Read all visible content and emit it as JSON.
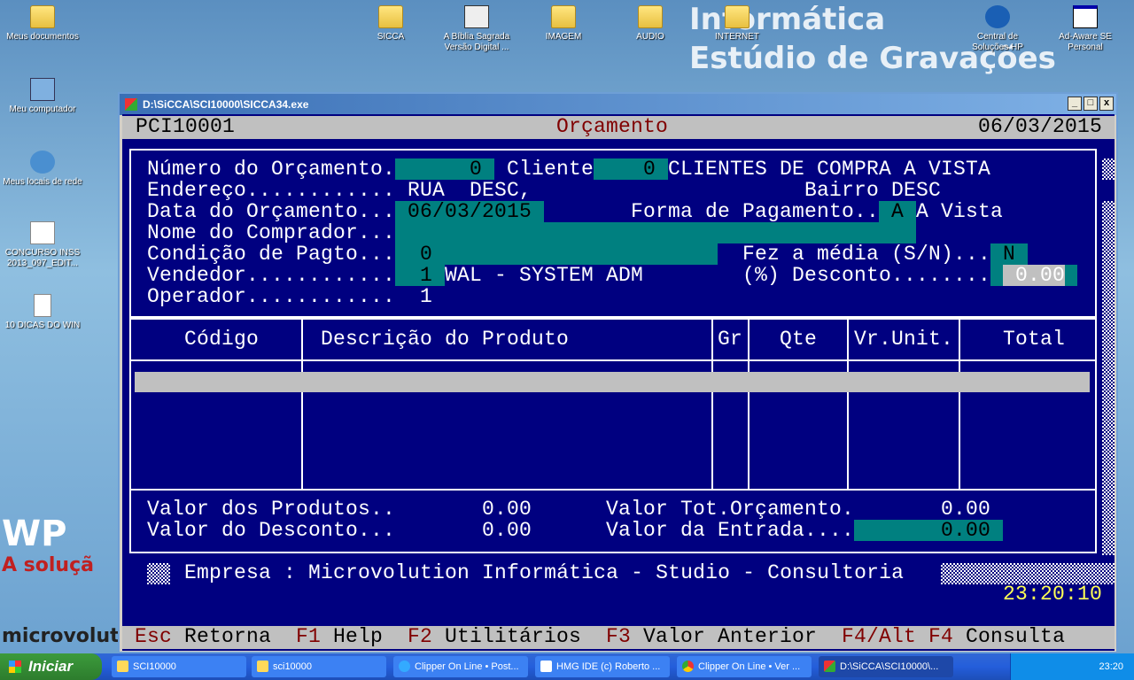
{
  "desktop": {
    "icons": [
      "Meus documentos",
      "Meu computador",
      "Meus locais de rede",
      "CONCURSO INSS 2013_097_EDIT...",
      "10 DICAS DO WIN",
      "SICCA",
      "A Bíblia Sagrada Versão Digital ...",
      "IMAGEM",
      "AUDIO",
      "INTERNET",
      "Central de Soluções HP",
      "Ad-Aware SE Personal"
    ],
    "wallpaper_text": [
      "Informática",
      "Estúdio de Gravações",
      "WP",
      "A soluçã",
      "microvolutio"
    ]
  },
  "window": {
    "title": "D:\\SiCCA\\SCI10000\\SICCA34.exe",
    "min": "_",
    "max": "□",
    "close": "x"
  },
  "console": {
    "header": {
      "code": "PCI10001",
      "title": "Orçamento",
      "date": "06/03/2015"
    },
    "form": {
      "numero_label": "Número do Orçamento.",
      "numero_value": "0",
      "cliente_label": "Cliente",
      "cliente_value": "0",
      "cliente_name": "CLIENTES DE COMPRA A VISTA",
      "endereco_label": "Endereço............",
      "endereco_value": "RUA  DESC,",
      "bairro_label": "Bairro",
      "bairro_value": "DESC",
      "data_label": "Data do Orçamento...",
      "data_value": "06/03/2015",
      "forma_label": "Forma de Pagamento..",
      "forma_value": "A",
      "forma_desc": "A Vista",
      "nome_label": "Nome do Comprador...",
      "nome_value": "",
      "condicao_label": "Condição de Pagto...",
      "condicao_value": "0",
      "media_label": "Fez a média (S/N)...",
      "media_value": "N",
      "vendedor_label": "Vendedor............",
      "vendedor_value": "1",
      "vendedor_name": "WAL - SYSTEM ADM",
      "desconto_label": "(%) Desconto........",
      "desconto_value": "0.00",
      "operador_label": "Operador............",
      "operador_value": "1"
    },
    "table": {
      "columns": [
        "Código",
        "Descrição do Produto",
        "Gr",
        "Qte",
        "Vr.Unit.",
        "Total"
      ],
      "rows": []
    },
    "totals": {
      "produtos_label": "Valor dos Produtos..",
      "produtos_value": "0.00",
      "desconto_label": "Valor do Desconto...",
      "desconto_value": "0.00",
      "tot_label": "Valor Tot.Orçamento.",
      "tot_value": "0.00",
      "entrada_label": "Valor da Entrada....",
      "entrada_value": "0.00"
    },
    "empresa": "Empresa : Microvolution Informática - Studio - Consultoria",
    "time": "23:20:10",
    "keys": [
      {
        "key": "Esc",
        "label": "Retorna"
      },
      {
        "key": "F1",
        "label": "Help"
      },
      {
        "key": "F2",
        "label": "Utilitários"
      },
      {
        "key": "F3",
        "label": "Valor Anterior"
      },
      {
        "key": "F4/Alt F4",
        "label": "Consulta"
      }
    ]
  },
  "taskbar": {
    "start": "Iniciar",
    "tasks": [
      "SCI10000",
      "sci10000",
      "Clipper On Line • Post...",
      "HMG IDE (c) Roberto ...",
      "Clipper On Line • Ver ...",
      "D:\\SiCCA\\SCI10000\\..."
    ],
    "clock": "23:20"
  }
}
